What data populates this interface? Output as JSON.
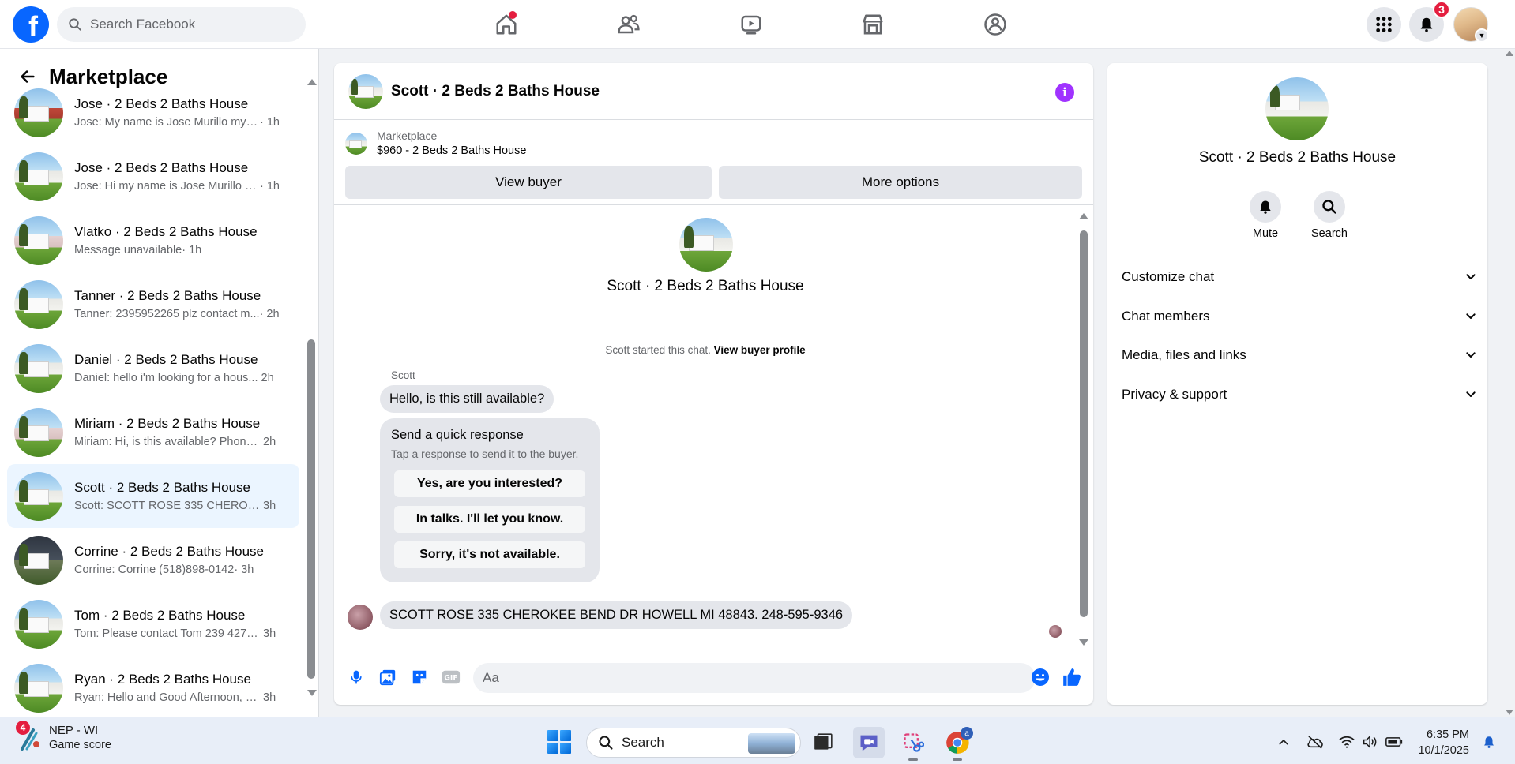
{
  "topbar": {
    "search_placeholder": "Search Facebook",
    "notifications_count": "3",
    "brand_color": "#0866ff"
  },
  "sidebar": {
    "title": "Marketplace",
    "conversations": [
      {
        "title": "Jose · 2 Beds 2 Baths House",
        "preview": "Jose: My name is Jose Murillo my n...",
        "time": "· 1h",
        "thumb": "red"
      },
      {
        "title": "Jose · 2 Beds 2 Baths House",
        "preview": "Jose: Hi my name is Jose Murillo a...",
        "time": "· 1h",
        "thumb": ""
      },
      {
        "title": "Vlatko · 2 Beds 2 Baths House",
        "preview": "Message unavailable",
        "time": "· 1h",
        "thumb": "pink"
      },
      {
        "title": "Tanner · 2 Beds 2 Baths House",
        "preview": "Tanner: 2395952265 plz contact m...",
        "time": "· 2h",
        "thumb": ""
      },
      {
        "title": "Daniel · 2 Beds 2 Baths House",
        "preview": "Daniel: hello i'm looking for a hous...",
        "time": "2h",
        "thumb": ""
      },
      {
        "title": "Miriam · 2 Beds 2 Baths House",
        "preview": "Miriam: Hi, is this available? Phone ...",
        "time": "2h",
        "thumb": "pink"
      },
      {
        "title": "Scott · 2 Beds 2 Baths House",
        "preview": "Scott: SCOTT ROSE 335 CHEROKEE ...",
        "time": "3h",
        "thumb": "",
        "active": true
      },
      {
        "title": "Corrine · 2 Beds 2 Baths House",
        "preview": "Corrine: Corrine (518)898-0142",
        "time": "· 3h",
        "thumb": "dark"
      },
      {
        "title": "Tom · 2 Beds 2 Baths House",
        "preview": "Tom: Please contact Tom 239 427 6...",
        "time": "3h",
        "thumb": ""
      },
      {
        "title": "Ryan · 2 Beds 2 Baths House",
        "preview": "Ryan: Hello and Good Afternoon, I ...",
        "time": "3h",
        "thumb": ""
      }
    ]
  },
  "chat": {
    "title": "Scott · 2 Beds 2 Baths House",
    "marketplace_label": "Marketplace",
    "listing": "$960 - 2 Beds 2 Baths House",
    "view_buyer": "View buyer",
    "more_options": "More options",
    "center_name": "Scott · 2 Beds 2 Baths House",
    "started_text": "Scott started this chat. ",
    "view_buyer_profile": "View buyer profile",
    "sender": "Scott",
    "first_message": "Hello, is this still available?",
    "quick_title": "Send a quick response",
    "quick_sub": "Tap a response to send it to the buyer.",
    "quick_responses": [
      "Yes, are you interested?",
      "In talks. I'll let you know.",
      "Sorry, it's not available."
    ],
    "last_message": "SCOTT ROSE 335 CHEROKEE BEND DR HOWELL MI 48843. 248-595-9346",
    "composer_placeholder": "Aa"
  },
  "rpanel": {
    "name": "Scott · 2 Beds 2 Baths House",
    "mute": "Mute",
    "search": "Search",
    "sections": [
      "Customize chat",
      "Chat members",
      "Media, files and links",
      "Privacy & support"
    ]
  },
  "taskbar": {
    "widget_badge": "4",
    "widget_title": "NEP - WI",
    "widget_sub": "Game score",
    "search_placeholder": "Search",
    "chrome_badge": "a",
    "time": "6:35 PM",
    "date": "10/1/2025"
  }
}
